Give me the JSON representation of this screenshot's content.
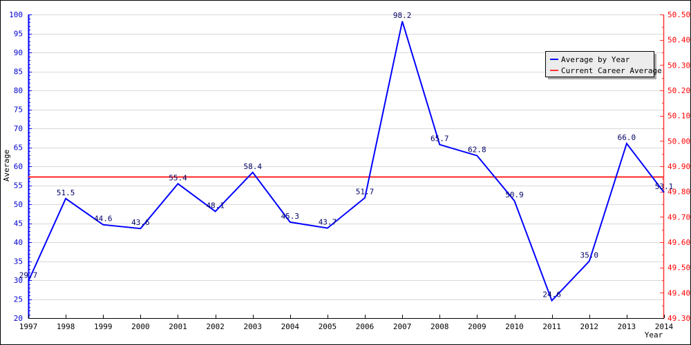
{
  "chart_data": {
    "type": "line",
    "title": "",
    "xlabel": "Year",
    "ylabel": "Average",
    "x": [
      "1997",
      "1998",
      "1999",
      "2000",
      "2001",
      "2002",
      "2003",
      "2004",
      "2005",
      "2006",
      "2007",
      "2008",
      "2009",
      "2010",
      "2011",
      "2012",
      "2013",
      "2014"
    ],
    "series": [
      {
        "name": "Average by Year",
        "color": "#0000ff",
        "axis": "left",
        "values": [
          29.7,
          51.5,
          44.6,
          43.6,
          55.4,
          48.1,
          58.4,
          45.3,
          43.7,
          51.7,
          98.2,
          65.7,
          62.8,
          50.9,
          24.6,
          35.0,
          66.0,
          53.1
        ],
        "labels": [
          "29.7",
          "51.5",
          "44.6",
          "43.6",
          "55.4",
          "48.1",
          "58.4",
          "45.3",
          "43.7",
          "51.7",
          "98.2",
          "65.7",
          "62.8",
          "50.9",
          "24.6",
          "35.0",
          "66.0",
          "53.1"
        ]
      },
      {
        "name": "Current Career Average",
        "color": "#ff0000",
        "axis": "right",
        "value": 49.86
      }
    ],
    "y_left": {
      "range": [
        20,
        100
      ],
      "ticks": [
        "20",
        "25",
        "30",
        "35",
        "40",
        "45",
        "50",
        "55",
        "60",
        "65",
        "70",
        "75",
        "80",
        "85",
        "90",
        "95",
        "100"
      ],
      "color": "#0000cc"
    },
    "y_right": {
      "range": [
        49.3,
        50.5
      ],
      "ticks": [
        "49.30",
        "49.40",
        "49.50",
        "49.60",
        "49.70",
        "49.80",
        "49.90",
        "50.00",
        "50.10",
        "50.20",
        "50.30",
        "50.40",
        "50.50"
      ],
      "color": "#ff0000"
    },
    "grid": true,
    "legend_position": "top-right"
  },
  "legend": {
    "items": [
      {
        "label": "Average by Year",
        "color": "#0000ff"
      },
      {
        "label": "Current Career Average",
        "color": "#ff3333"
      }
    ]
  }
}
